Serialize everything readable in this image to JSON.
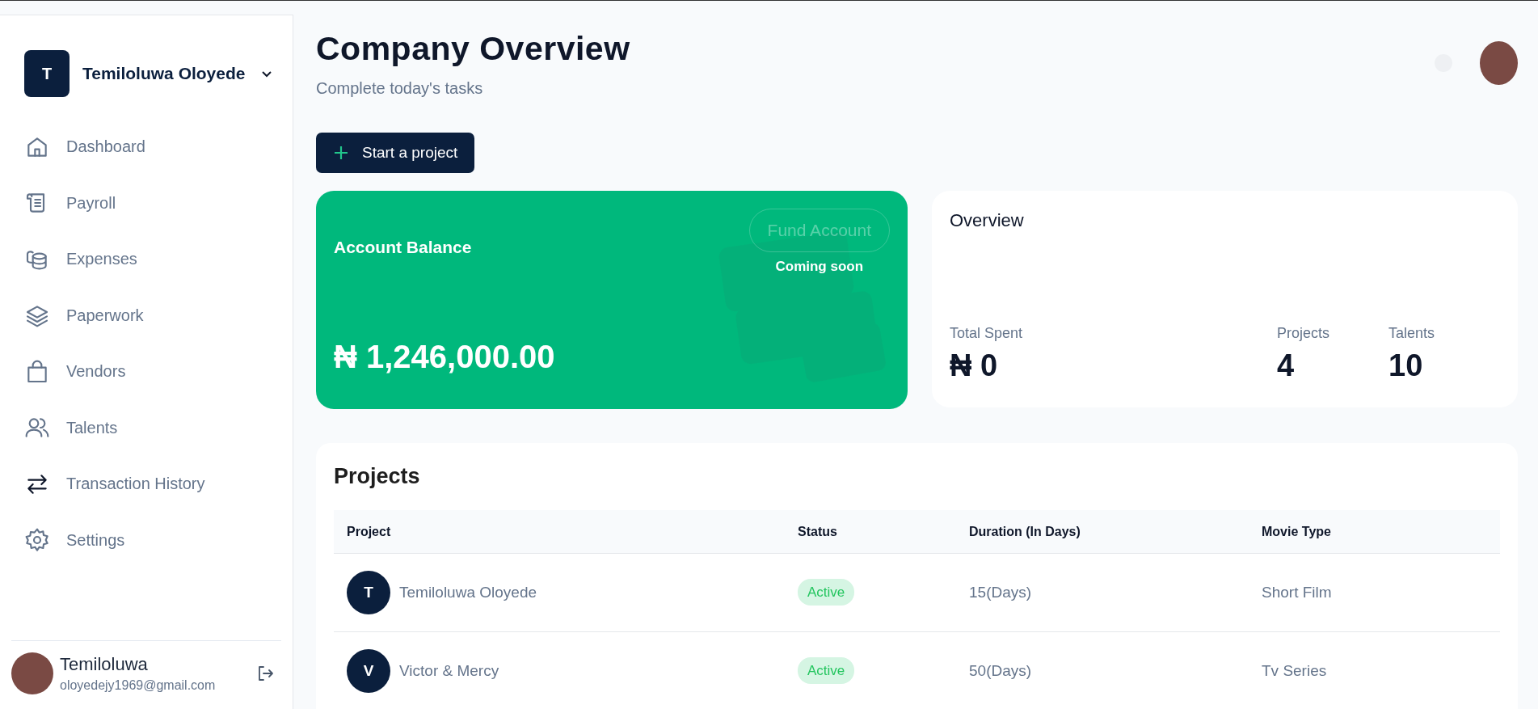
{
  "sidebar": {
    "team": {
      "initial": "T",
      "name": "Temiloluwa Oloyede"
    },
    "items": [
      {
        "label": "Dashboard"
      },
      {
        "label": "Payroll"
      },
      {
        "label": "Expenses"
      },
      {
        "label": "Paperwork"
      },
      {
        "label": "Vendors"
      },
      {
        "label": "Talents"
      },
      {
        "label": "Transaction History"
      },
      {
        "label": "Settings"
      }
    ],
    "user": {
      "name": "Temiloluwa",
      "email": "oloyedejy1969@gmail.com"
    }
  },
  "header": {
    "title": "Company Overview",
    "subtitle": "Complete today's tasks"
  },
  "start_button": {
    "label": "Start a project"
  },
  "balance_card": {
    "title": "Account Balance",
    "fund_button": {
      "label": "Fund Account",
      "disabled": true
    },
    "note": "Coming soon",
    "amount": "₦ 1,246,000.00"
  },
  "overview": {
    "title": "Overview",
    "stats": [
      {
        "label": "Total Spent",
        "value": "₦ 0"
      },
      {
        "label": "Projects",
        "value": "4"
      },
      {
        "label": "Talents",
        "value": "10"
      }
    ]
  },
  "projects": {
    "title": "Projects",
    "columns": [
      "Project",
      "Status",
      "Duration (In Days)",
      "Movie Type"
    ],
    "rows": [
      {
        "initial": "T",
        "name": "Temiloluwa Oloyede",
        "status": "Active",
        "duration": "15(Days)",
        "type": "Short Film"
      },
      {
        "initial": "V",
        "name": "Victor & Mercy",
        "status": "Active",
        "duration": "50(Days)",
        "type": "Tv Series"
      }
    ]
  }
}
